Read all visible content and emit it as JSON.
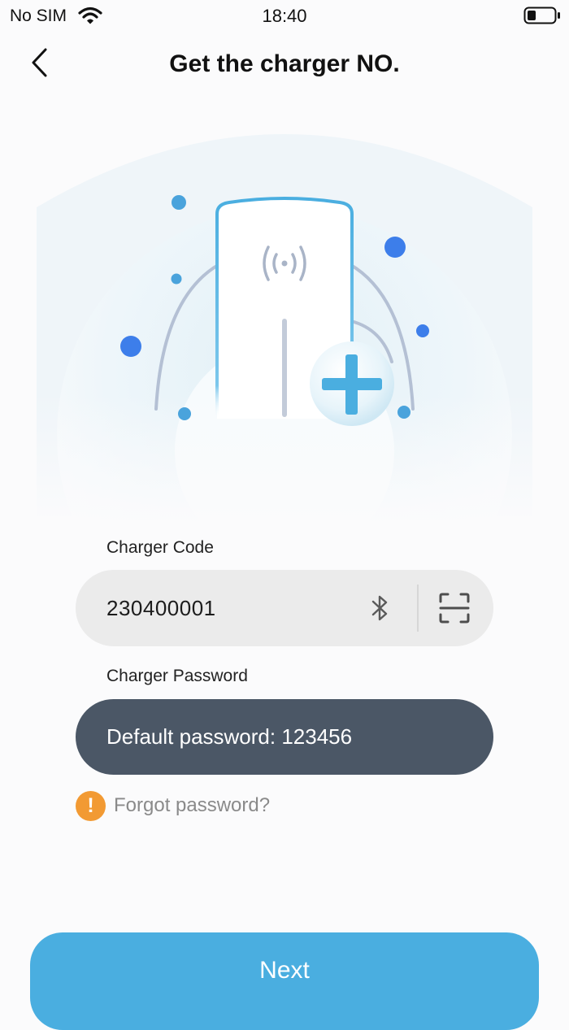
{
  "status_bar": {
    "carrier": "No SIM",
    "time": "18:40",
    "wifi_icon": "wifi-icon",
    "battery_icon": "battery-icon"
  },
  "header": {
    "back_icon": "chevron-left-icon",
    "title": "Get the charger NO."
  },
  "hero": {
    "illustration": "charger-add-illustration",
    "accent_color": "#4aaee0"
  },
  "form": {
    "charger_code": {
      "label": "Charger Code",
      "value": "230400001",
      "bluetooth_icon": "bluetooth-icon",
      "scan_icon": "scan-icon"
    },
    "charger_password": {
      "label": "Charger Password",
      "placeholder": "Default password: 123456"
    },
    "forgot": {
      "icon": "warning-icon",
      "icon_glyph": "!",
      "icon_color": "#f29a33",
      "label": "Forgot password?"
    }
  },
  "footer": {
    "next_label": "Next",
    "next_color": "#4aaee0"
  }
}
